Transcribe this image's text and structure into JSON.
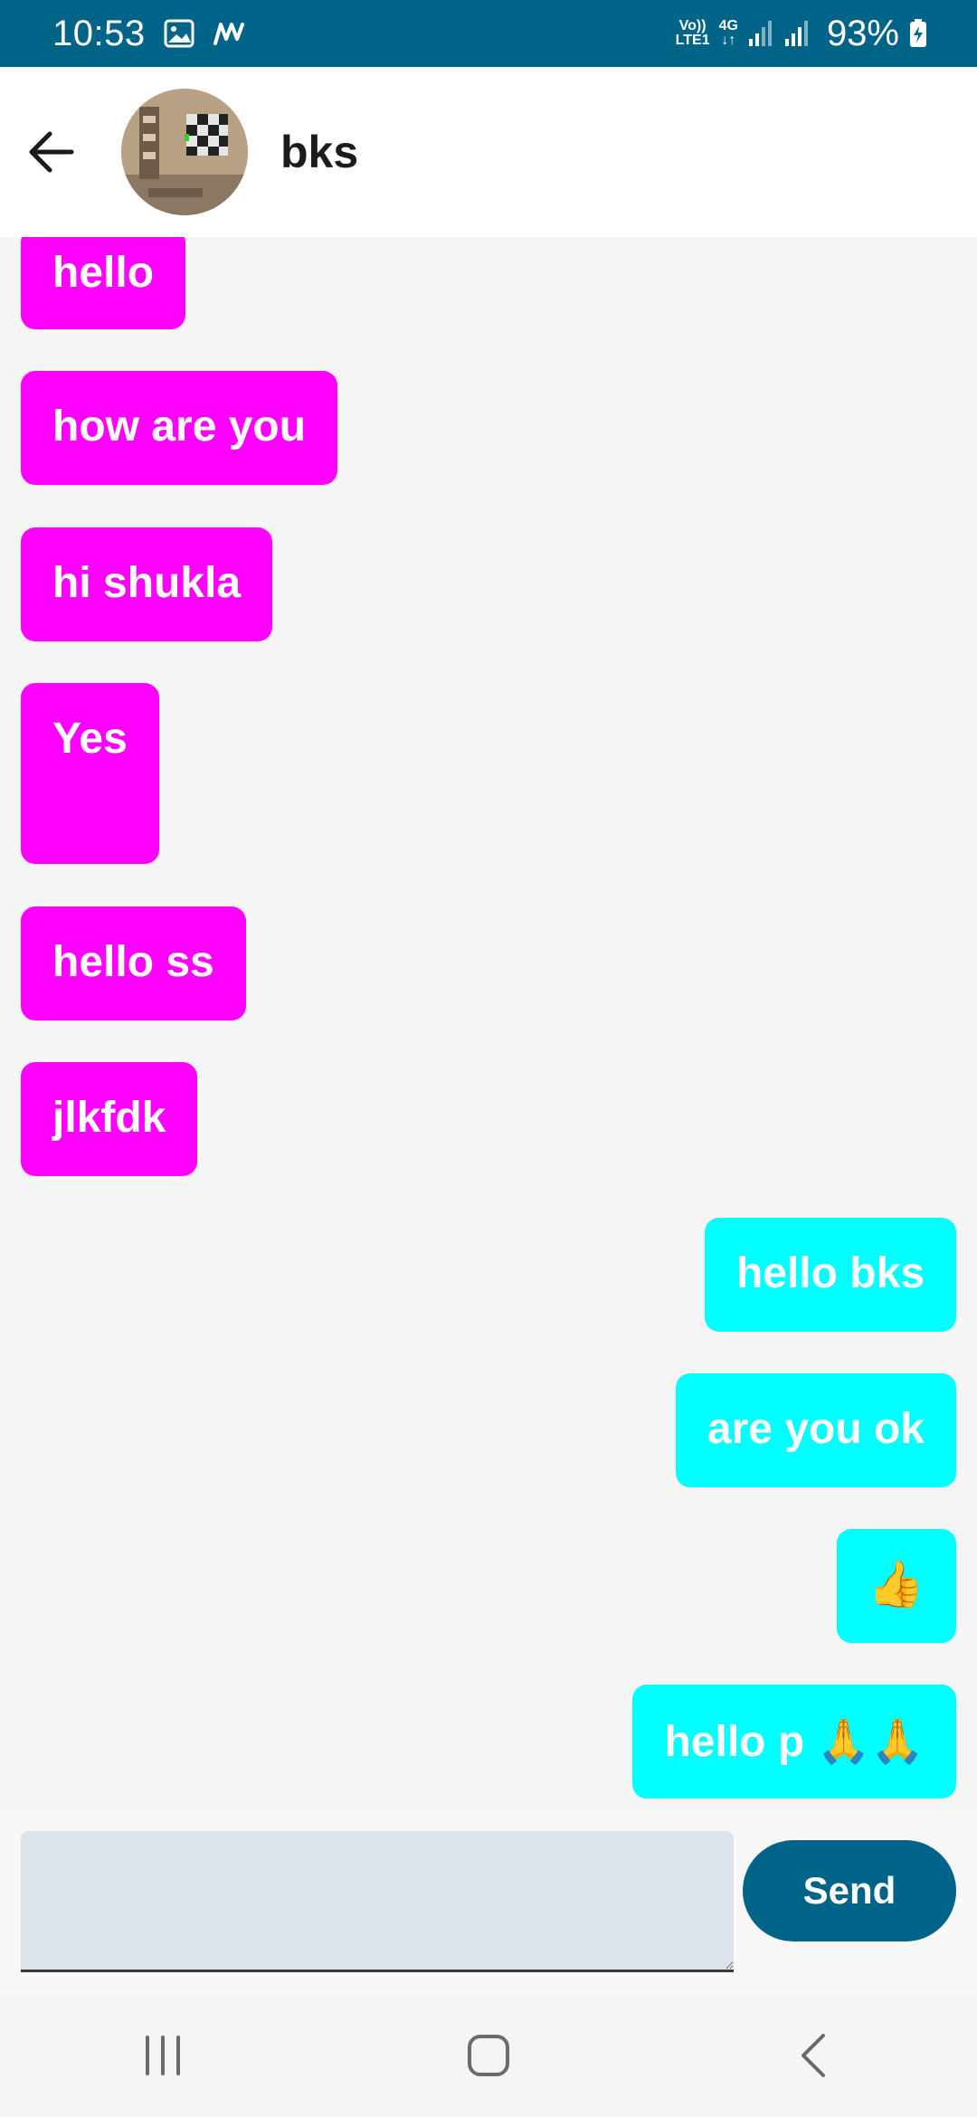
{
  "status_bar": {
    "time": "10:53",
    "network_top": "Vo))",
    "network_bottom": "LTE1",
    "data_type": "4G",
    "battery": "93%"
  },
  "header": {
    "contact_name": "bks"
  },
  "messages": [
    {
      "text": "hello",
      "direction": "incoming"
    },
    {
      "text": "how are you",
      "direction": "incoming"
    },
    {
      "text": "hi shukla",
      "direction": "incoming"
    },
    {
      "text": "Yes",
      "direction": "incoming"
    },
    {
      "text": "hello ss",
      "direction": "incoming"
    },
    {
      "text": "jlkfdk",
      "direction": "incoming"
    },
    {
      "text": "hello bks",
      "direction": "outgoing"
    },
    {
      "text": "are you ok",
      "direction": "outgoing"
    },
    {
      "text": "👍",
      "direction": "outgoing"
    },
    {
      "text": "hello p 🙏🙏",
      "direction": "outgoing"
    }
  ],
  "composer": {
    "value": "",
    "send_label": "Send"
  },
  "colors": {
    "incoming_bubble": "#ff00ff",
    "outgoing_bubble": "#00ffff",
    "accent": "#006488"
  },
  "icons": {
    "back": "arrow-left-icon",
    "nav_recents": "recents-icon",
    "nav_home": "home-icon",
    "nav_back": "nav-back-icon"
  }
}
